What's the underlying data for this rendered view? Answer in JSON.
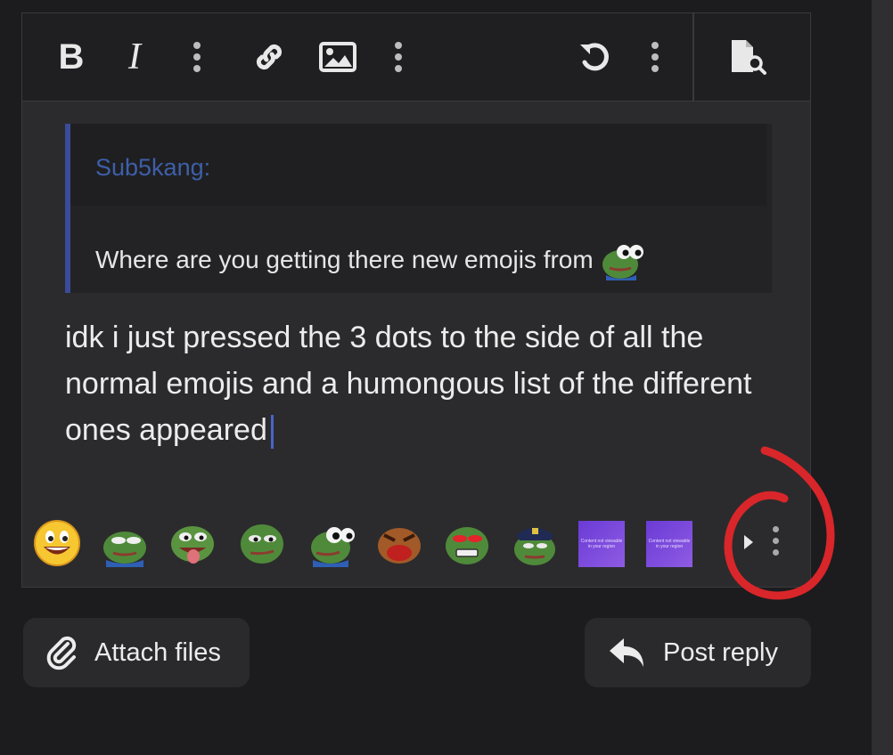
{
  "toolbar": {
    "bold_label": "B",
    "italic_label": "I"
  },
  "quote": {
    "author": "Sub5kang:",
    "text": "Where are you getting there new emojis from"
  },
  "reply": {
    "text": "idk i just pressed the 3 dots to the side of all the normal emojis and a humongous list of the different ones appeared"
  },
  "emoji_bar": {
    "restricted_label_line1": "Content not viewable",
    "restricted_label_line2": "in your region"
  },
  "actions": {
    "attach_label": "Attach files",
    "post_label": "Post reply"
  },
  "colors": {
    "accent": "#3a4c98",
    "annotation": "#d9262a"
  }
}
